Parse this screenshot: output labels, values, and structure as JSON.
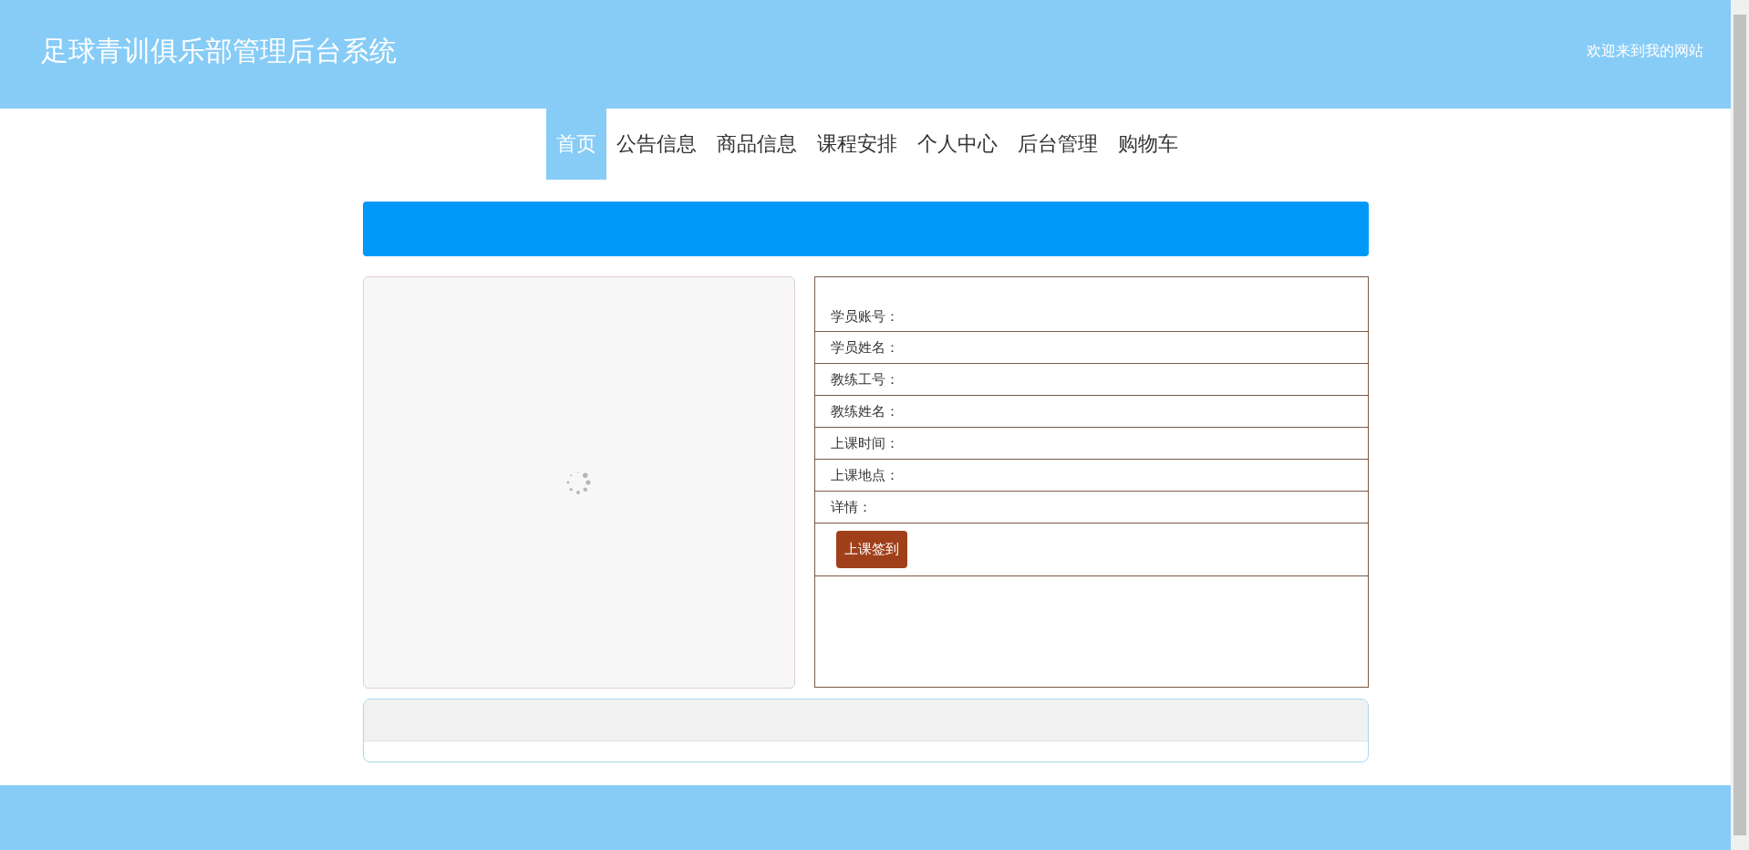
{
  "header": {
    "title": "足球青训俱乐部管理后台系统",
    "welcome": "欢迎来到我的网站"
  },
  "nav": [
    {
      "label": "首页",
      "selected": true
    },
    {
      "label": "公告信息",
      "selected": false
    },
    {
      "label": "商品信息",
      "selected": false
    },
    {
      "label": "课程安排",
      "selected": false
    },
    {
      "label": "个人中心",
      "selected": false
    },
    {
      "label": "后台管理",
      "selected": false
    },
    {
      "label": "购物车",
      "selected": false
    }
  ],
  "image_panel": {
    "loading": true
  },
  "form": {
    "fields": [
      {
        "label": "学员账号："
      },
      {
        "label": "学员姓名："
      },
      {
        "label": "教练工号："
      },
      {
        "label": "教练姓名："
      },
      {
        "label": "上课时间："
      },
      {
        "label": "上课地点："
      },
      {
        "label": "详情："
      }
    ],
    "button": "上课签到"
  }
}
